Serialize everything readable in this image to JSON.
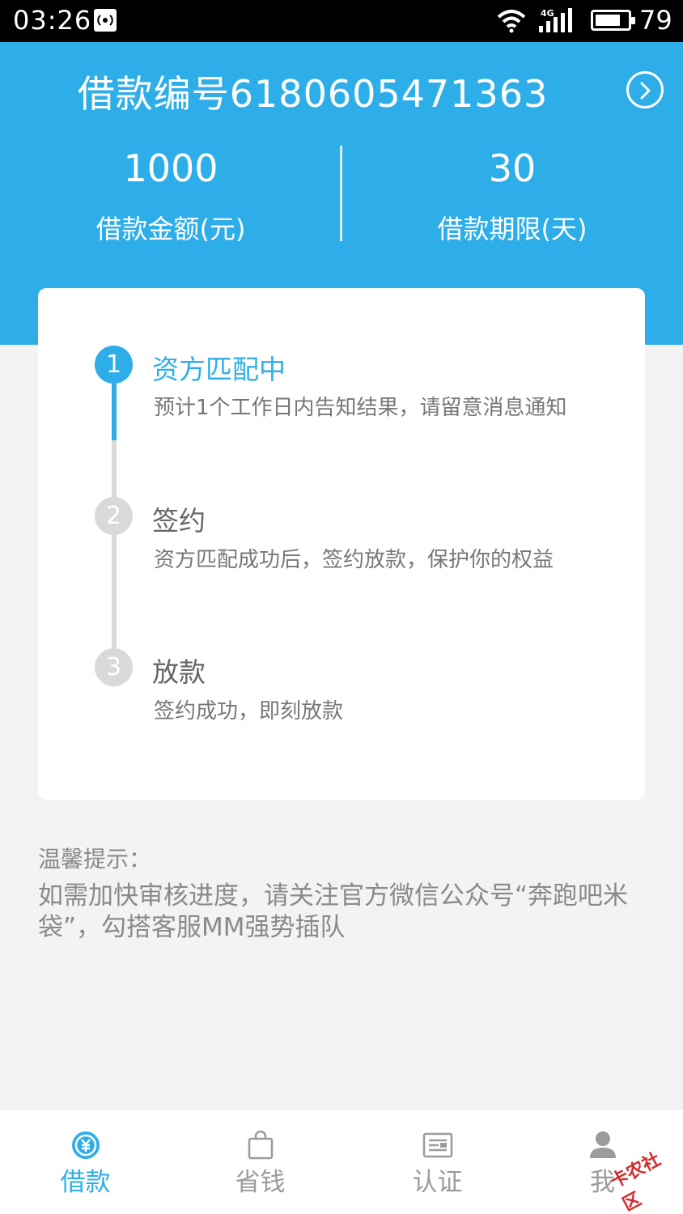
{
  "status_bar": {
    "time": "03:26",
    "battery_level": "79",
    "network": "4G"
  },
  "header": {
    "loan_number_label": "借款编号6180605471363",
    "amount": {
      "value": "1000",
      "label": "借款金额(元)"
    },
    "term": {
      "value": "30",
      "label": "借款期限(天)"
    }
  },
  "steps": [
    {
      "number": "1",
      "title": "资方匹配中",
      "description": "预计1个工作日内告知结果，请留意消息通知",
      "active": true
    },
    {
      "number": "2",
      "title": "签约",
      "description": "资方匹配成功后，签约放款，保护你的权益",
      "active": false
    },
    {
      "number": "3",
      "title": "放款",
      "description": "签约成功，即刻放款",
      "active": false
    }
  ],
  "tips": {
    "title": "温馨提示：",
    "body": "如需加快审核进度，请关注官方微信公众号“奔跑吧米袋”，勾搭客服MM强势插队"
  },
  "tabbar": {
    "items": [
      {
        "label": "借款",
        "icon": "yuan-circle-icon",
        "active": true
      },
      {
        "label": "省钱",
        "icon": "shopping-bag-icon",
        "active": false
      },
      {
        "label": "认证",
        "icon": "id-card-icon",
        "active": false
      },
      {
        "label": "我",
        "icon": "person-icon",
        "active": false
      }
    ]
  },
  "watermark": {
    "text": "卡农社区"
  },
  "colors": {
    "accent": "#2eaee8",
    "inactive_step": "#d9d9d9",
    "background": "#f3f3f4"
  }
}
